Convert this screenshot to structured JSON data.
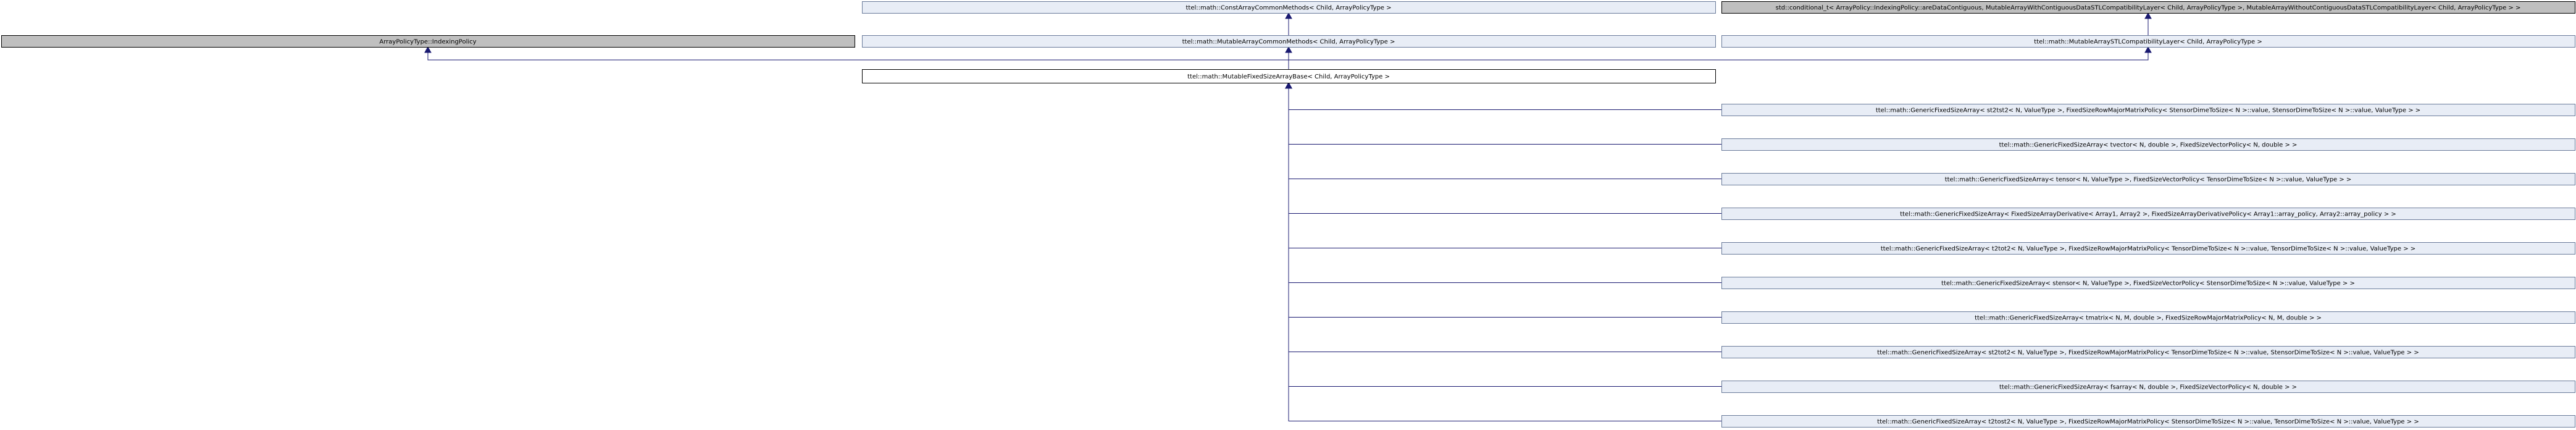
{
  "diagram": {
    "type": "class-inheritance-graph",
    "colors": {
      "node_fill": "#e8edf6",
      "node_stroke": "#6a7b9a",
      "focus_fill": "#ffffff",
      "focus_stroke": "#000000",
      "external_fill": "#bfbfbf",
      "external_stroke": "#000000",
      "edge": "#191970"
    },
    "nodes": [
      {
        "id": "const_common",
        "label": "ttel::math::ConstArrayCommonMethods< Child, ArrayPolicyType >",
        "style": "normal"
      },
      {
        "id": "std_conditional",
        "label": "std::conditional_t< ArrayPolicy::IndexingPolicy::areDataContiguous, MutableArrayWithContiguousDataSTLCompatibilityLayer< Child, ArrayPolicyType >, MutableArrayWithoutContiguousDataSTLCompatibilityLayer< Child, ArrayPolicyType > >",
        "style": "external"
      },
      {
        "id": "indexing_policy",
        "label": "ArrayPolicyType::IndexingPolicy",
        "style": "external"
      },
      {
        "id": "mutable_common",
        "label": "ttel::math::MutableArrayCommonMethods< Child, ArrayPolicyType >",
        "style": "normal"
      },
      {
        "id": "mutable_stl",
        "label": "ttel::math::MutableArraySTLCompatibilityLayer< Child, ArrayPolicyType >",
        "style": "normal"
      },
      {
        "id": "mutable_fixed_base",
        "label": "ttel::math::MutableFixedSizeArrayBase< Child, ArrayPolicyType >",
        "style": "focus"
      },
      {
        "id": "d0",
        "label": "ttel::math::GenericFixedSizeArray< st2tst2< N, ValueType >, FixedSizeRowMajorMatrixPolicy< StensorDimeToSize< N >::value, StensorDimeToSize< N >::value, ValueType > >",
        "style": "normal"
      },
      {
        "id": "d1",
        "label": "ttel::math::GenericFixedSizeArray< tvector< N, double >, FixedSizeVectorPolicy< N, double > >",
        "style": "normal"
      },
      {
        "id": "d2",
        "label": "ttel::math::GenericFixedSizeArray< tensor< N, ValueType >, FixedSizeVectorPolicy< TensorDimeToSize< N >::value, ValueType > >",
        "style": "normal"
      },
      {
        "id": "d3",
        "label": "ttel::math::GenericFixedSizeArray< FixedSizeArrayDerivative< Array1, Array2 >, FixedSizeArrayDerivativePolicy< Array1::array_policy, Array2::array_policy > >",
        "style": "normal"
      },
      {
        "id": "d4",
        "label": "ttel::math::GenericFixedSizeArray< t2tot2< N, ValueType >, FixedSizeRowMajorMatrixPolicy< TensorDimeToSize< N >::value, TensorDimeToSize< N >::value, ValueType > >",
        "style": "normal"
      },
      {
        "id": "d5",
        "label": "ttel::math::GenericFixedSizeArray< stensor< N, ValueType >, FixedSizeVectorPolicy< StensorDimeToSize< N >::value, ValueType > >",
        "style": "normal"
      },
      {
        "id": "d6",
        "label": "ttel::math::GenericFixedSizeArray< tmatrix< N, M, double >, FixedSizeRowMajorMatrixPolicy< N, M, double > >",
        "style": "normal"
      },
      {
        "id": "d7",
        "label": "ttel::math::GenericFixedSizeArray< st2tot2< N, ValueType >, FixedSizeRowMajorMatrixPolicy< TensorDimeToSize< N >::value, StensorDimeToSize< N >::value, ValueType > >",
        "style": "normal"
      },
      {
        "id": "d8",
        "label": "ttel::math::GenericFixedSizeArray< fsarray< N, double >, FixedSizeVectorPolicy< N, double > >",
        "style": "normal"
      },
      {
        "id": "d9",
        "label": "ttel::math::GenericFixedSizeArray< t2tost2< N, ValueType >, FixedSizeRowMajorMatrixPolicy< StensorDimeToSize< N >::value, TensorDimeToSize< N >::value, ValueType > >",
        "style": "normal"
      }
    ],
    "edges": [
      {
        "from": "mutable_common",
        "to": "const_common"
      },
      {
        "from": "mutable_stl",
        "to": "std_conditional"
      },
      {
        "from": "mutable_fixed_base",
        "to": "indexing_policy"
      },
      {
        "from": "mutable_fixed_base",
        "to": "mutable_common"
      },
      {
        "from": "mutable_fixed_base",
        "to": "mutable_stl"
      },
      {
        "from": "d0",
        "to": "mutable_fixed_base"
      },
      {
        "from": "d1",
        "to": "mutable_fixed_base"
      },
      {
        "from": "d2",
        "to": "mutable_fixed_base"
      },
      {
        "from": "d3",
        "to": "mutable_fixed_base"
      },
      {
        "from": "d4",
        "to": "mutable_fixed_base"
      },
      {
        "from": "d5",
        "to": "mutable_fixed_base"
      },
      {
        "from": "d6",
        "to": "mutable_fixed_base"
      },
      {
        "from": "d7",
        "to": "mutable_fixed_base"
      },
      {
        "from": "d8",
        "to": "mutable_fixed_base"
      },
      {
        "from": "d9",
        "to": "mutable_fixed_base"
      }
    ]
  }
}
